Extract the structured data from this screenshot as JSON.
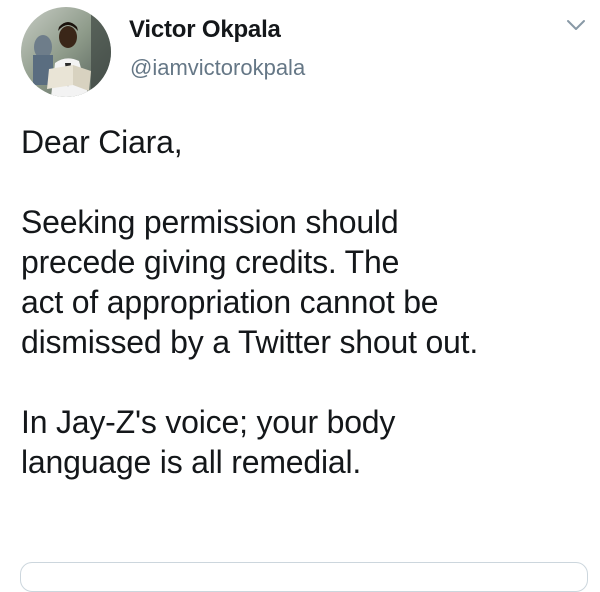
{
  "author": {
    "name": "Victor Okpala",
    "handle": "@iamvictorokpala"
  },
  "icons": {
    "menu": "chevron-down-icon",
    "avatar": "profile-photo"
  },
  "tweet": {
    "paragraphs": [
      {
        "lines": [
          "Dear Ciara,"
        ]
      },
      {
        "lines": [
          "Seeking permission should",
          "precede giving credits. The",
          "act of appropriation cannot be",
          "dismissed by a Twitter shout out."
        ]
      },
      {
        "lines": [
          "In Jay-Z's voice; your body",
          "language is all remedial."
        ]
      }
    ]
  },
  "colors": {
    "text": "#14171a",
    "secondary": "#657786",
    "border": "#ccd6dd"
  }
}
